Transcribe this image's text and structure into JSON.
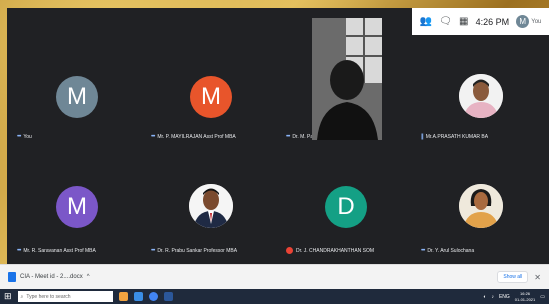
{
  "meet": {
    "topbar": {
      "time": "4:26 PM",
      "you_label": "You",
      "you_initial": "M",
      "icons": [
        "people-icon",
        "chat-icon",
        "activities-icon"
      ]
    },
    "participants": [
      {
        "name": "You",
        "initial": "M",
        "color": "#6f8796",
        "kind": "initial"
      },
      {
        "name": "Mr. P. MAYILRAJAN Asst Prof MBA",
        "initial": "M",
        "color": "#e8552b",
        "kind": "initial"
      },
      {
        "name": "Dr. M. Padmavathi ASSO. PROF. MBA",
        "kind": "video"
      },
      {
        "name": "Mr.A.PRASATH KUMAR BA",
        "kind": "photo"
      },
      {
        "name": "Mr. R. Saravanan Asst Prof MBA",
        "initial": "M",
        "color": "#7b57c8",
        "kind": "initial"
      },
      {
        "name": "Dr. R. Prabu Sankar Professor MBA",
        "kind": "photo"
      },
      {
        "name": "Dr. J. CHANDRAKHANTHAN SOM",
        "initial": "D",
        "color": "#14a085",
        "kind": "initial"
      },
      {
        "name": "Dr. Y. Arul Sulochana",
        "kind": "photo"
      }
    ]
  },
  "downloads": {
    "file_name": "CIA - Meet id - 2....docx",
    "show_all": "Show all"
  },
  "taskbar": {
    "search_placeholder": "Type here to search",
    "lang": "ENG",
    "time": "16:26",
    "date": "01-01-2021"
  }
}
